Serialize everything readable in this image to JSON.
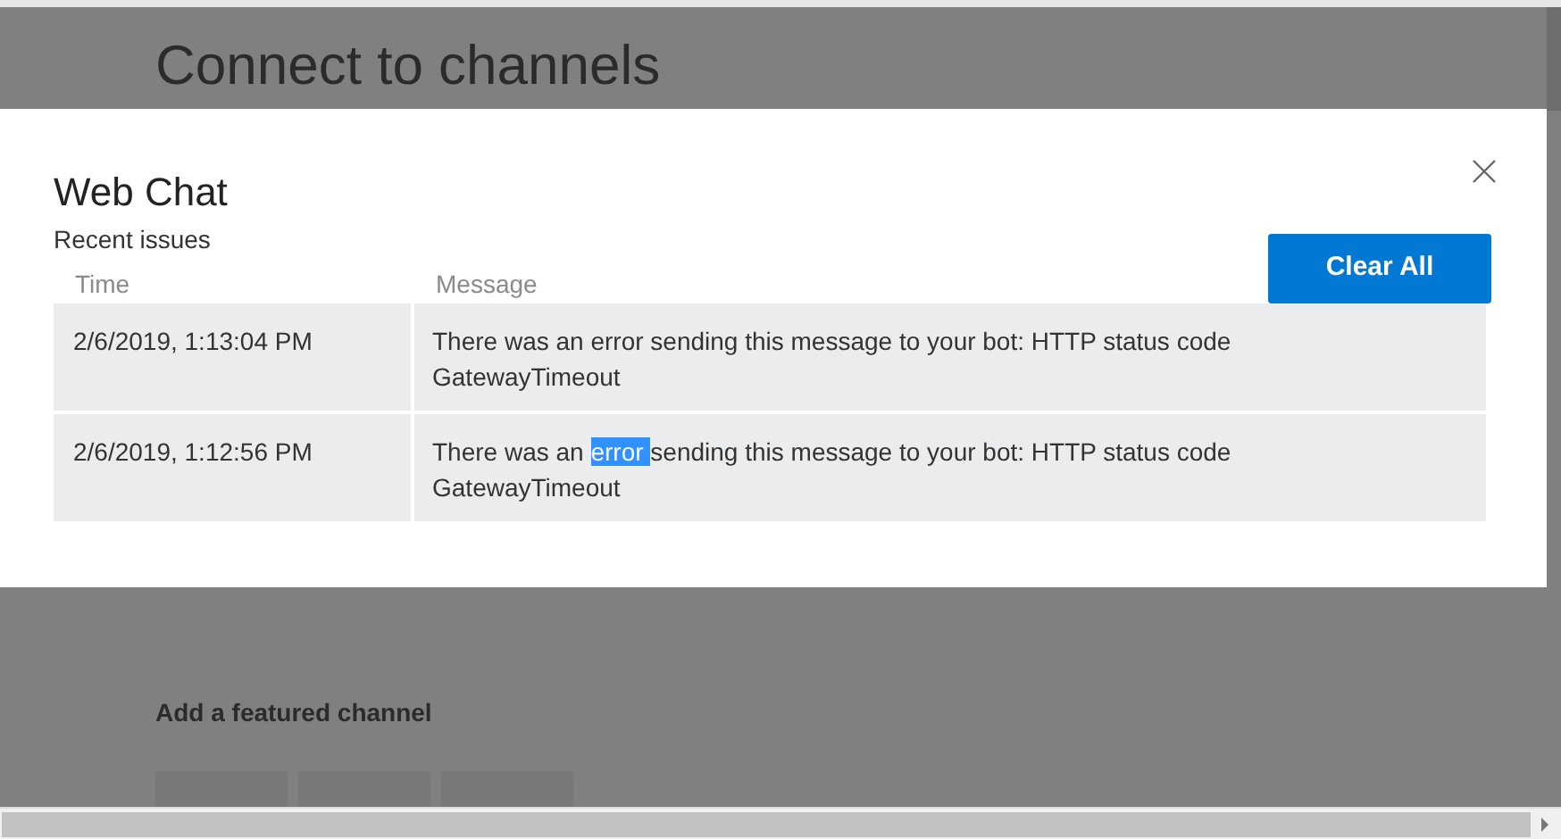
{
  "background": {
    "heading": "Connect to channels",
    "section_title": "Add a featured channel"
  },
  "dialog": {
    "title": "Web Chat",
    "subtitle": "Recent issues",
    "clear_button": "Clear All",
    "table": {
      "columns": [
        "Time",
        "Message"
      ],
      "rows": [
        {
          "time": "2/6/2019, 1:13:04 PM",
          "message": [
            {
              "text": "There was an error sending this message to your bot: HTTP status code GatewayTimeout",
              "selected": false
            }
          ]
        },
        {
          "time": "2/6/2019, 1:12:56 PM",
          "message": [
            {
              "text": "There was an ",
              "selected": false
            },
            {
              "text": "error ",
              "selected": true
            },
            {
              "text": "sending this message to your bot: HTTP status code GatewayTimeout",
              "selected": false
            }
          ]
        }
      ]
    }
  }
}
